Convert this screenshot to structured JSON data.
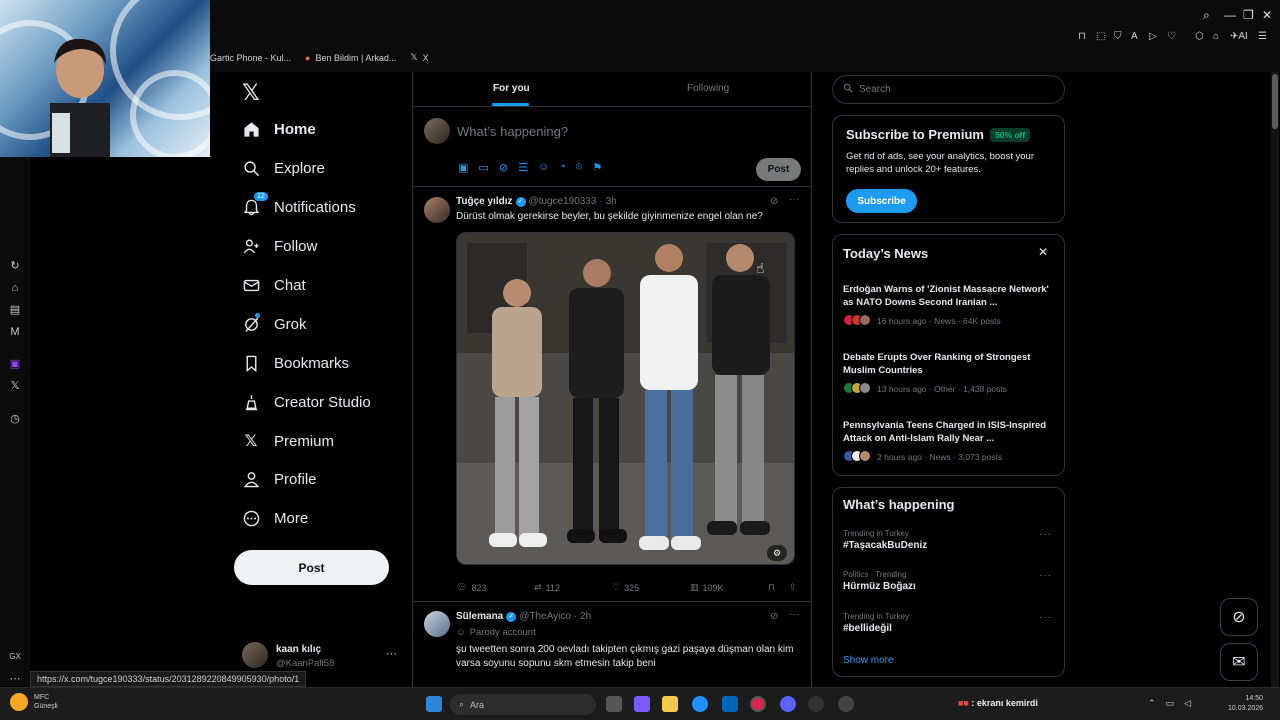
{
  "browser": {
    "tabs": [
      {
        "label": "Gartic Phone - Kul..."
      },
      {
        "label": "Ben Bildim | Arkad..."
      },
      {
        "label": "X"
      }
    ],
    "status_url": "https://x.com/tugce190333/status/2031289220849905930/photo/1"
  },
  "nav": {
    "logo": "X",
    "items": [
      {
        "label": "Home",
        "icon": "home-icon"
      },
      {
        "label": "Explore",
        "icon": "search-icon"
      },
      {
        "label": "Notifications",
        "icon": "bell-icon",
        "badge": "12"
      },
      {
        "label": "Follow",
        "icon": "person-add-icon"
      },
      {
        "label": "Chat",
        "icon": "mail-icon"
      },
      {
        "label": "Grok",
        "icon": "grok-icon"
      },
      {
        "label": "Bookmarks",
        "icon": "bookmark-icon"
      },
      {
        "label": "Creator Studio",
        "icon": "creator-icon"
      },
      {
        "label": "Premium",
        "icon": "x-icon"
      },
      {
        "label": "Profile",
        "icon": "person-icon"
      },
      {
        "label": "More",
        "icon": "more-circle-icon"
      }
    ],
    "post_button": "Post",
    "account": {
      "name": "kaan kılıç",
      "handle": "@KaanPall58"
    }
  },
  "feed": {
    "tabs": [
      "For you",
      "Following"
    ],
    "composer_placeholder": "What’s happening?",
    "composer_post": "Post",
    "tweets": [
      {
        "name": "Tuğçe yıldız",
        "handle": "@tugce190333",
        "time": "· 3h",
        "text": "Dürüst olmak gerekirse beyler, bu şekilde giyinmenize engel olan ne?",
        "replies": "823",
        "reposts": "112",
        "likes": "325",
        "views": "109K"
      },
      {
        "name": "Sülemana",
        "handle": "@TheAyico",
        "time": "· 2h",
        "parody": "Parody account",
        "text": "şu tweetten sonra 200 oevladı takipten çıkmış gazi paşaya düşman olan kim varsa soyunu sopunu skm etmesin takip beni"
      }
    ]
  },
  "sidebar": {
    "search_placeholder": "Search",
    "premium": {
      "title": "Subscribe to Premium",
      "badge": "50% off",
      "text": "Get rid of ads, see your analytics, boost your replies and unlock 20+ features.",
      "button": "Subscribe"
    },
    "news": {
      "title": "Today’s News",
      "items": [
        {
          "title": "Erdoğan Warns of 'Zionist Massacre Network' as NATO Downs Second Iranian ...",
          "meta": "16 hours ago · News · 64K posts"
        },
        {
          "title": "Debate Erupts Over Ranking of Strongest Muslim Countries",
          "meta": "13 hours ago · Other · 1,438 posts"
        },
        {
          "title": "Pennsylvania Teens Charged in ISIS-Inspired Attack on Anti-Islam Rally Near ...",
          "meta": "2 hours ago · News · 3,073 posts"
        }
      ]
    },
    "happening": {
      "title": "What’s happening",
      "items": [
        {
          "context": "Trending in Turkey",
          "name": "#TaşacakBuDeniz"
        },
        {
          "context": "Politics · Trending",
          "name": "Hürmüz Boğazı"
        },
        {
          "context": "Trending in Turkey",
          "name": "#bellideğil"
        }
      ],
      "show_more": "Show more"
    }
  },
  "taskbar": {
    "search": "Ara",
    "weather": "MFC",
    "weather_sub": "Güneşli",
    "notification": ": ekranı kemirdi",
    "clock_time": "14:50",
    "clock_date": "10.03.2026"
  },
  "colors": {
    "accent": "#1d9bf0",
    "background": "#000000",
    "border": "#2f3336",
    "premium_badge": "#00ba7c"
  }
}
